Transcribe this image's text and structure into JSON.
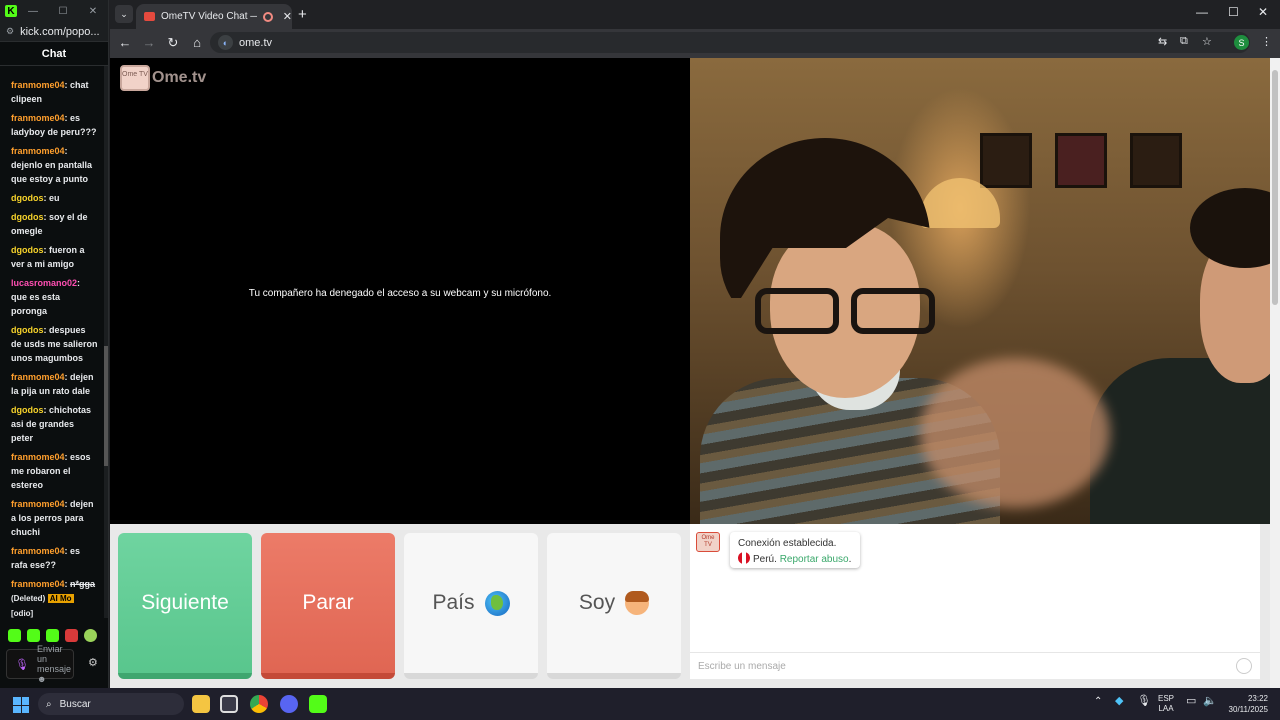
{
  "kick": {
    "url": "kick.com/popo...",
    "chat_label": "Chat",
    "messages": [
      {
        "user": "franmome04",
        "color": "orange",
        "text": ": chat clipeen"
      },
      {
        "user": "franmome04",
        "color": "orange",
        "text": ": es ladyboy de peru???"
      },
      {
        "user": "franmome04",
        "color": "orange",
        "text": ": dejenlo en pantalla que estoy a punto"
      },
      {
        "user": "dgodos",
        "color": "yellow",
        "text": ": eu"
      },
      {
        "user": "dgodos",
        "color": "yellow",
        "text": ": soy el de omegle"
      },
      {
        "user": "dgodos",
        "color": "yellow",
        "text": ": fueron a ver a mi amigo"
      },
      {
        "user": "lucasromano02",
        "color": "pink",
        "text": ": que es esta poronga"
      },
      {
        "user": "dgodos",
        "color": "yellow",
        "text": ": despues de usds me salieron unos magumbos"
      },
      {
        "user": "franmome04",
        "color": "orange",
        "text": ": dejen la pija un rato dale"
      },
      {
        "user": "dgodos",
        "color": "yellow",
        "text": ": chichotas asi de grandes peter"
      },
      {
        "user": "franmome04",
        "color": "orange",
        "text": ": esos me robaron el estereo"
      },
      {
        "user": "franmome04",
        "color": "orange",
        "text": ": dejen a los perros para chuchi"
      },
      {
        "user": "franmome04",
        "color": "orange",
        "text": ": es rafa ese??"
      }
    ],
    "deleted_msg": {
      "user": "franmome04",
      "text": "n*gga",
      "deleted": "(Deleted)",
      "tag": "AI Mo",
      "extra": "[odio]"
    },
    "send_placeholder": "Enviar un mensaje",
    "send_emoji": "☻"
  },
  "browser": {
    "tab_title": "OmeTV Video Chat — Ome",
    "url": "ome.tv",
    "profile_initial": "S"
  },
  "ometv": {
    "logo_box": "Ome TV",
    "logo_text": "Ome.tv",
    "denied_text": "Tu compañero ha denegado el acceso a su webcam y su micrófono.",
    "buttons": {
      "next": "Siguiente",
      "stop": "Parar",
      "country": "País",
      "gender": "Soy"
    },
    "chat": {
      "avatar_text": "Ome TV",
      "connected": "Conexión establecida.",
      "country": "Perú.",
      "report": "Reportar abuso",
      "report_suffix": ".",
      "input_placeholder": "Escribe un mensaje"
    }
  },
  "taskbar": {
    "search_label": "Buscar",
    "lang_line1": "ESP",
    "lang_line2": "LAA",
    "time": "23:22",
    "date": "30/11/2025"
  },
  "colors": {
    "next": "#59c68d",
    "stop": "#e06653",
    "kick_green": "#53fc18",
    "user_orange": "#ff9f2d",
    "user_yellow": "#f7d32b",
    "user_pink": "#ff4fb2"
  }
}
